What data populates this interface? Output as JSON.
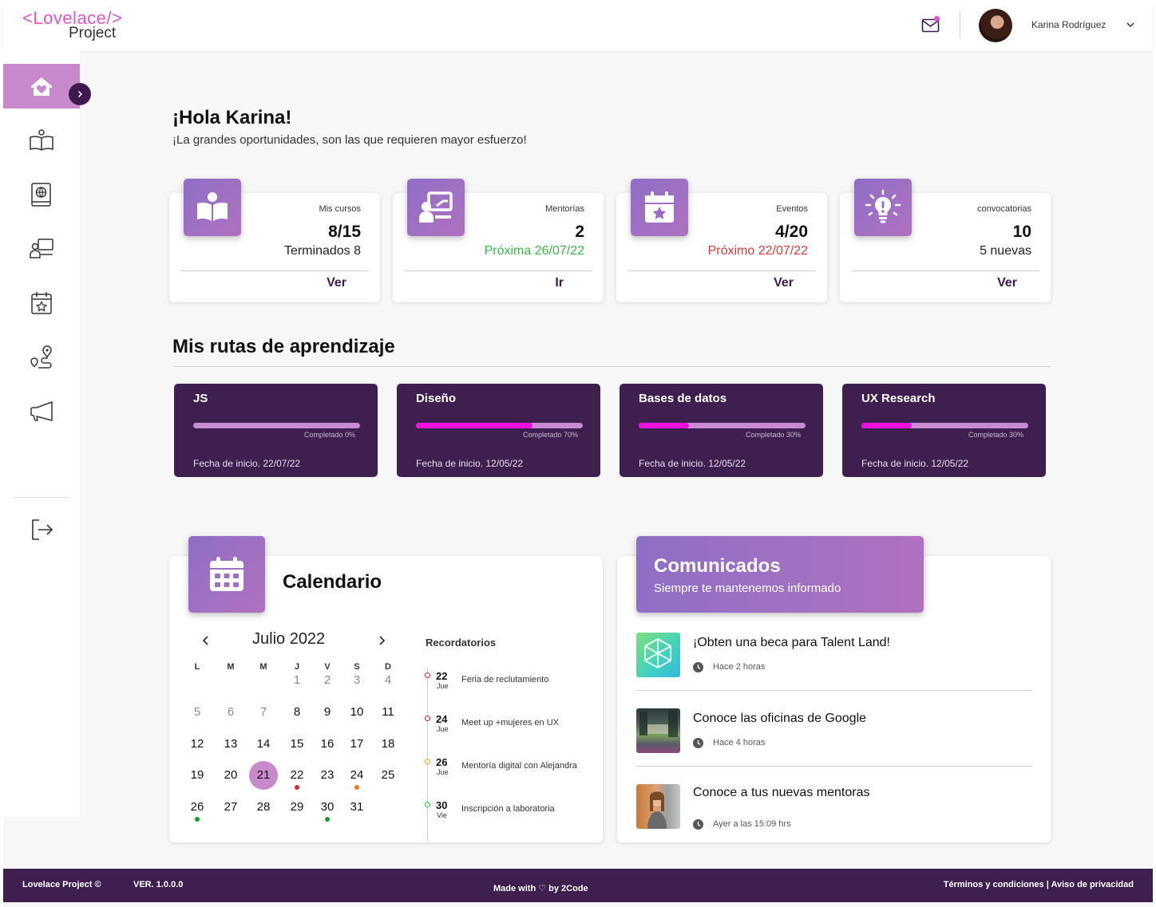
{
  "header": {
    "logo_top": "<Lovelace/>",
    "logo_bottom": "Project",
    "user_name": "Karina Rodríguez"
  },
  "greeting": {
    "title": "¡Hola Karina!",
    "subtitle": "¡La grandes oportunidades, son las que requieren mayor esfuerzo!"
  },
  "stats": [
    {
      "label": "Mis cursos",
      "value": "8/15",
      "sub": "Terminados 8",
      "link": "Ver",
      "icon": "book-reader-icon"
    },
    {
      "label": "Mentorías",
      "value": "2",
      "sub": "Próxima 26/07/22",
      "link": "Ir",
      "icon": "presentation-icon"
    },
    {
      "label": "Eventos",
      "value": "4/20",
      "sub": "Próximo 22/07/22",
      "link": "Ver",
      "icon": "calendar-star-icon"
    },
    {
      "label": "convocatorias",
      "value": "10",
      "sub": "5 nuevas",
      "link": "Ver",
      "icon": "lightbulb-icon"
    }
  ],
  "routes": {
    "title": "Mis rutas de aprendizaje",
    "items": [
      {
        "name": "JS",
        "progress": 0,
        "pct_label": "Completado 0%",
        "date": "Fecha de inicio. 22/07/22"
      },
      {
        "name": "Diseño",
        "progress": 70,
        "pct_label": "Completado 70%",
        "date": "Fecha de inicio. 12/05/22"
      },
      {
        "name": "Bases de datos",
        "progress": 30,
        "pct_label": "Completado 30%",
        "date": "Fecha de inicio. 12/05/22"
      },
      {
        "name": "UX Research",
        "progress": 30,
        "pct_label": "Completado 30%",
        "date": "Fecha de inicio. 12/05/22"
      }
    ]
  },
  "calendar": {
    "title": "Calendario",
    "month": "Julio 2022",
    "weekdays": [
      "L",
      "M",
      "M",
      "J",
      "V",
      "S",
      "D"
    ],
    "weeks": [
      [
        "",
        "",
        "",
        "1",
        "2",
        "3",
        "4"
      ],
      [
        "5",
        "6",
        "7",
        "8",
        "9",
        "10",
        "11"
      ],
      [
        "12",
        "13",
        "14",
        "15",
        "16",
        "17",
        "18"
      ],
      [
        "19",
        "20",
        "21",
        "22",
        "23",
        "24",
        "25"
      ],
      [
        "26",
        "27",
        "28",
        "29",
        "30",
        "31",
        ""
      ]
    ],
    "selected_day": "21",
    "colors": {
      "red": "#d9263a",
      "orange": "#f07a1a",
      "green": "#1a9a2a"
    },
    "reminders_title": "Recordatorios",
    "reminders": [
      {
        "day": "22",
        "dow": "Jue",
        "text": "Feria de reclutamiento",
        "color": "#d9263a"
      },
      {
        "day": "24",
        "dow": "Jue",
        "text": "Meet up +mujeres en UX",
        "color": "#b0203a"
      },
      {
        "day": "26",
        "dow": "Jue",
        "text": "Mentoría digital con Alejandra",
        "color": "#f0a020"
      },
      {
        "day": "30",
        "dow": "Vie",
        "text": "Inscripción a laboratoria",
        "color": "#3bb54a"
      }
    ]
  },
  "comunicados": {
    "title": "Comunicados",
    "subtitle": "Siempre te mantenemos informado",
    "items": [
      {
        "title": "¡Obten una beca para Talent Land!",
        "time": "Hace 2 horas"
      },
      {
        "title": "Conoce las oficinas de Google",
        "time": "Hace 4 horas"
      },
      {
        "title": "Conoce  a tus nuevas mentoras",
        "time": "Ayer a las 15:09 hrs"
      }
    ]
  },
  "footer": {
    "brand": "Lovelace Project ©",
    "version": "VER. 1.0.0.0",
    "made_with": "Made with ♡ by 2Code",
    "terms": "Términos y condiciones",
    "divider": "|",
    "privacy": "Aviso de privacidad"
  },
  "theme": {
    "accent": "#c888cc",
    "dark": "#3f1f4f",
    "pink": "#ee10dd"
  }
}
